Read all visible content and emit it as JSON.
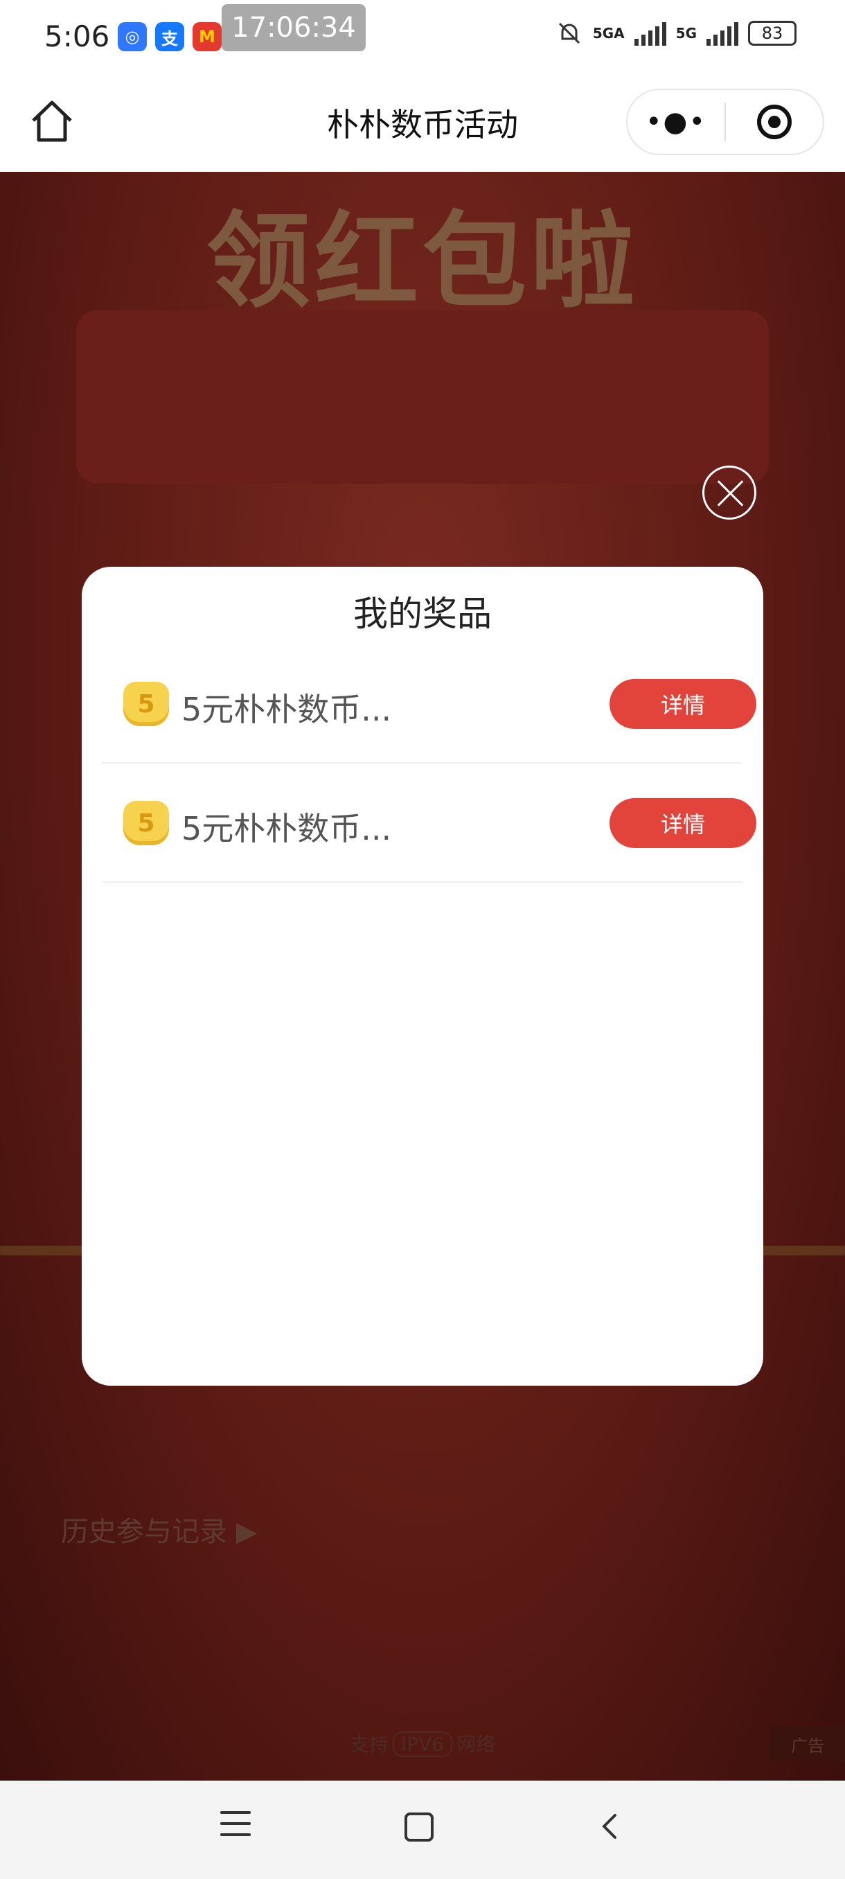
{
  "status_bar": {
    "time": "5:06",
    "clock_overlay": "17:06:34",
    "more_apps": "...",
    "net1": "5GA",
    "net2": "5G",
    "battery": "83"
  },
  "navbar": {
    "title": "朴朴数币活动"
  },
  "background": {
    "banner_title": "领红包啦",
    "history_link": "历史参与记录 ▶",
    "ipv6_prefix": "支持",
    "ipv6_badge": "IPV6",
    "ipv6_suffix": "网络",
    "ad_label": "广告"
  },
  "modal": {
    "title": "我的奖品",
    "prizes": [
      {
        "coin": "5",
        "name": "5元朴朴数币...",
        "button": "详情"
      },
      {
        "coin": "5",
        "name": "5元朴朴数币...",
        "button": "详情"
      }
    ]
  },
  "colors": {
    "accent": "#e2433a",
    "overlay_bg": "#5a1a14"
  }
}
